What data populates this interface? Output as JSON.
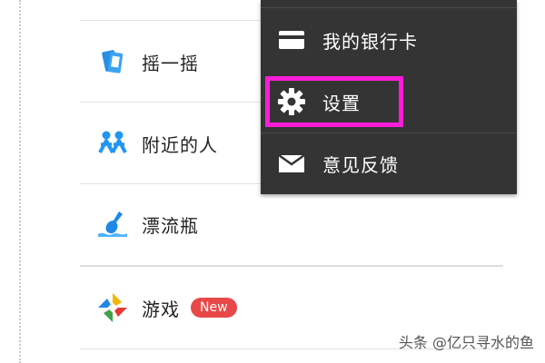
{
  "list": {
    "items": [
      {
        "label": "摇一摇",
        "icon": "shake-icon"
      },
      {
        "label": "附近的人",
        "icon": "people-nearby-icon"
      },
      {
        "label": "漂流瓶",
        "icon": "drift-bottle-icon"
      },
      {
        "label": "游戏",
        "icon": "game-icon",
        "badge": "New"
      }
    ]
  },
  "menu": {
    "items": [
      {
        "label": "我的银行卡",
        "icon": "bank-card-icon"
      },
      {
        "label": "设置",
        "icon": "gear-icon",
        "highlighted": true
      },
      {
        "label": "意见反馈",
        "icon": "envelope-icon"
      }
    ]
  },
  "colors": {
    "menu_background": "#343434",
    "highlight_border": "#ff1cd8",
    "badge_background": "#e84848",
    "icon_blue": "#2196f3"
  },
  "watermark": "头条 @亿只寻水的鱼"
}
